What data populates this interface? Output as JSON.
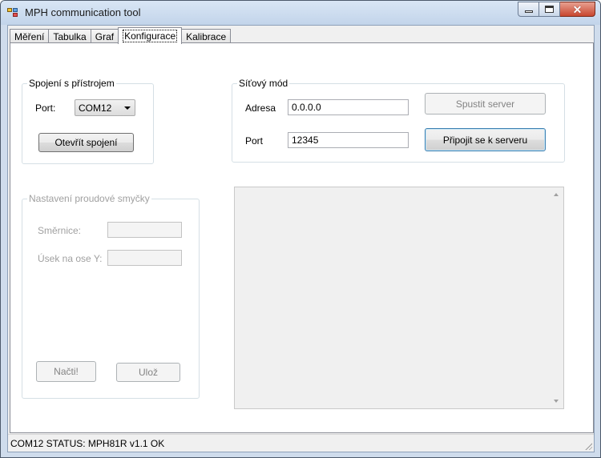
{
  "window": {
    "title": "MPH communication tool"
  },
  "tabs": [
    {
      "label": "Měření"
    },
    {
      "label": "Tabulka"
    },
    {
      "label": "Graf"
    },
    {
      "label": "Konfigurace",
      "active": true
    },
    {
      "label": "Kalibrace"
    }
  ],
  "device_group": {
    "legend": "Spojení s přístrojem",
    "port_label": "Port:",
    "port_value": "COM12",
    "open_button": "Otevřít spojení"
  },
  "network_group": {
    "legend": "Síťový mód",
    "address_label": "Adresa",
    "address_value": "0.0.0.0",
    "port_label": "Port",
    "port_value": "12345",
    "start_server_button": "Spustit server",
    "connect_button": "Připojit se k serveru"
  },
  "current_loop_group": {
    "legend": "Nastavení proudové smyčky",
    "slope_label": "Směrnice:",
    "slope_value": "",
    "intercept_label": "Úsek na ose Y:",
    "intercept_value": "",
    "load_button": "Načti!",
    "save_button": "Ulož"
  },
  "log": {
    "text": ""
  },
  "statusbar": {
    "text": "COM12  STATUS: MPH81R v1.1 OK"
  }
}
